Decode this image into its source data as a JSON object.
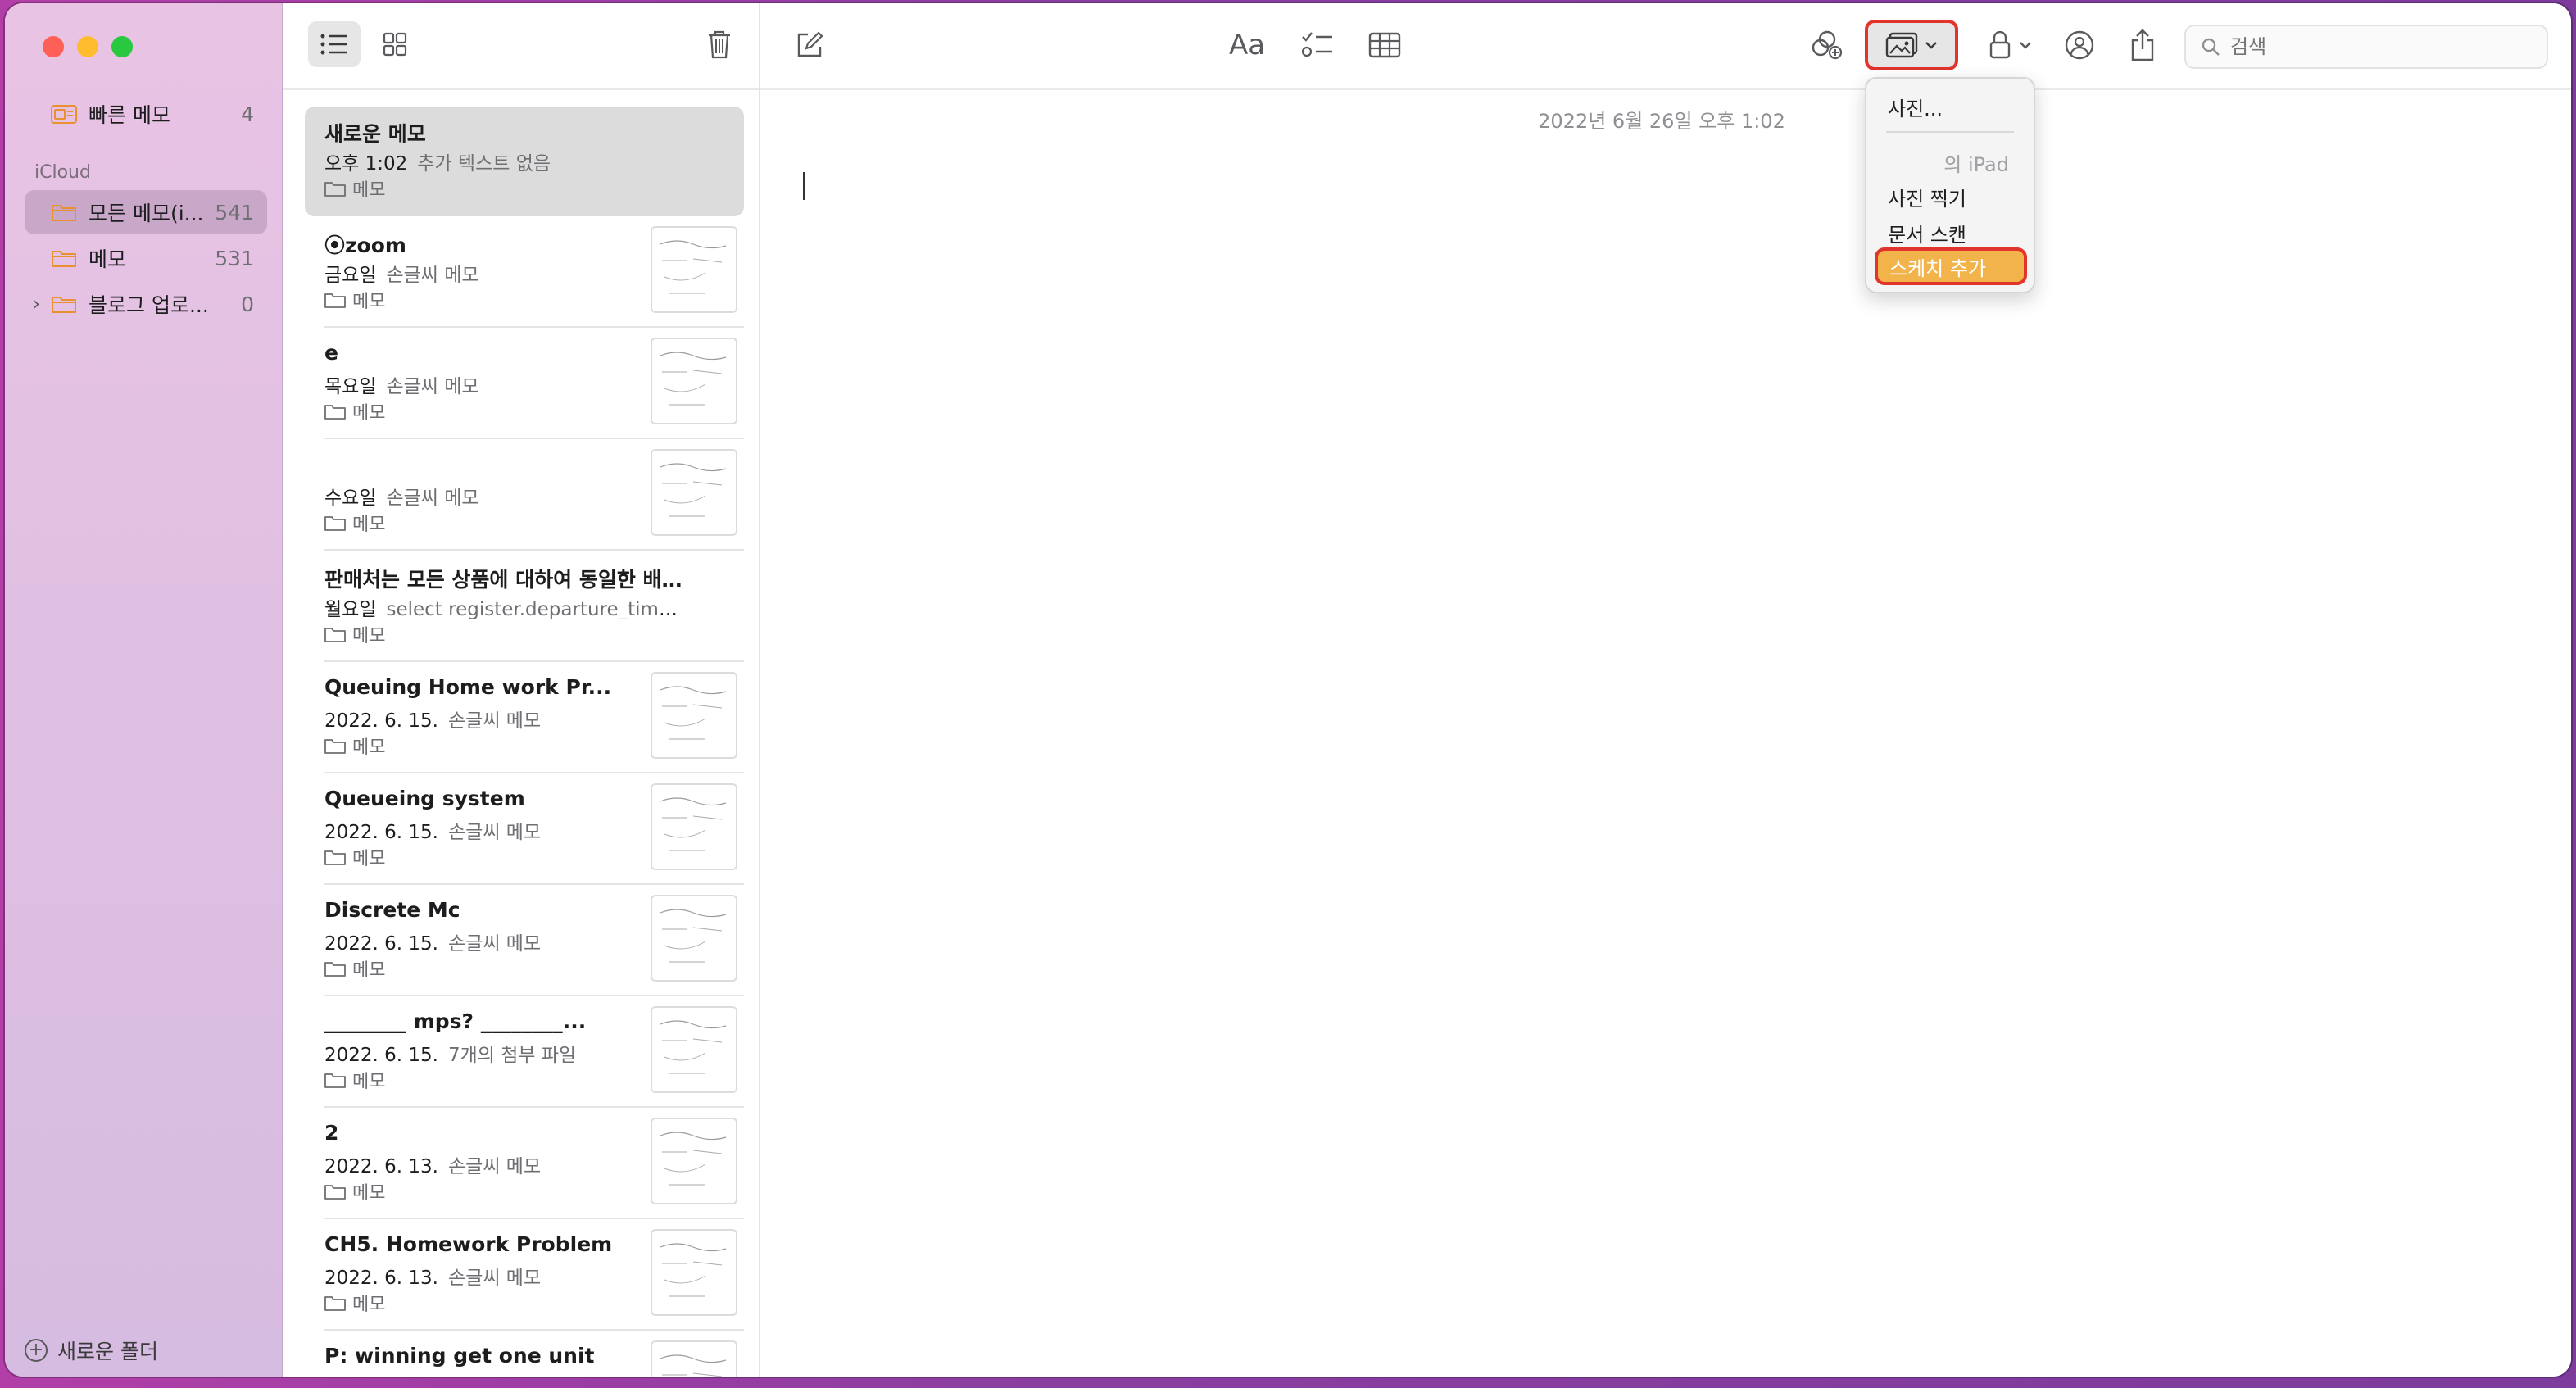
{
  "sidebar": {
    "quick_notes": {
      "label": "빠른 메모",
      "count": "4"
    },
    "section_label": "iCloud",
    "folders": [
      {
        "label": "모든 메모(i...",
        "count": "541"
      },
      {
        "label": "메모",
        "count": "531"
      },
      {
        "label": "블로그 업로...",
        "count": "0"
      }
    ],
    "new_folder": "새로운 폴더"
  },
  "notes": [
    {
      "title": "새로운 메모",
      "date": "오후 1:02",
      "sub": "추가 텍스트 없음",
      "folder": "메모"
    },
    {
      "title": "⦿zoom",
      "date": "금요일",
      "sub": "손글씨 메모",
      "folder": "메모"
    },
    {
      "title": "e",
      "date": "목요일",
      "sub": "손글씨 메모",
      "folder": "메모"
    },
    {
      "title": "",
      "date": "수요일",
      "sub": "손글씨 메모",
      "folder": "메모"
    },
    {
      "title": "판매처는 모든 상품에 대하여 동일한 배송...",
      "date": "월요일",
      "sub": "select register.departure_time...",
      "folder": "메모"
    },
    {
      "title": "Queuing Home work Pr...",
      "date": "2022. 6. 15.",
      "sub": "손글씨 메모",
      "folder": "메모"
    },
    {
      "title": "Queueing system",
      "date": "2022. 6. 15.",
      "sub": "손글씨 메모",
      "folder": "메모"
    },
    {
      "title": "Discrete Mc",
      "date": "2022. 6. 15.",
      "sub": "손글씨 메모",
      "folder": "메모"
    },
    {
      "title": "________ mps? ________...",
      "date": "2022. 6. 15.",
      "sub": "7개의 첨부 파일",
      "folder": "메모"
    },
    {
      "title": "2",
      "date": "2022. 6. 13.",
      "sub": "손글씨 메모",
      "folder": "메모"
    },
    {
      "title": "CH5. Homework Problem",
      "date": "2022. 6. 13.",
      "sub": "손글씨 메모",
      "folder": "메모"
    },
    {
      "title": "P: winning get one unit",
      "date": "",
      "sub": "",
      "folder": ""
    }
  ],
  "editor": {
    "format_label": "Aa",
    "date_stamp": "2022년 6월 26일 오후 1:02",
    "search_placeholder": "검색"
  },
  "media_menu": {
    "photo": "사진...",
    "device": "의 iPad",
    "take_photo": "사진 찍기",
    "scan_doc": "문서 스캔",
    "add_sketch": "스케치 추가"
  },
  "colors": {
    "accent": "#f2b34a",
    "highlight_border": "#e0342d",
    "folder": "#e8912e"
  }
}
